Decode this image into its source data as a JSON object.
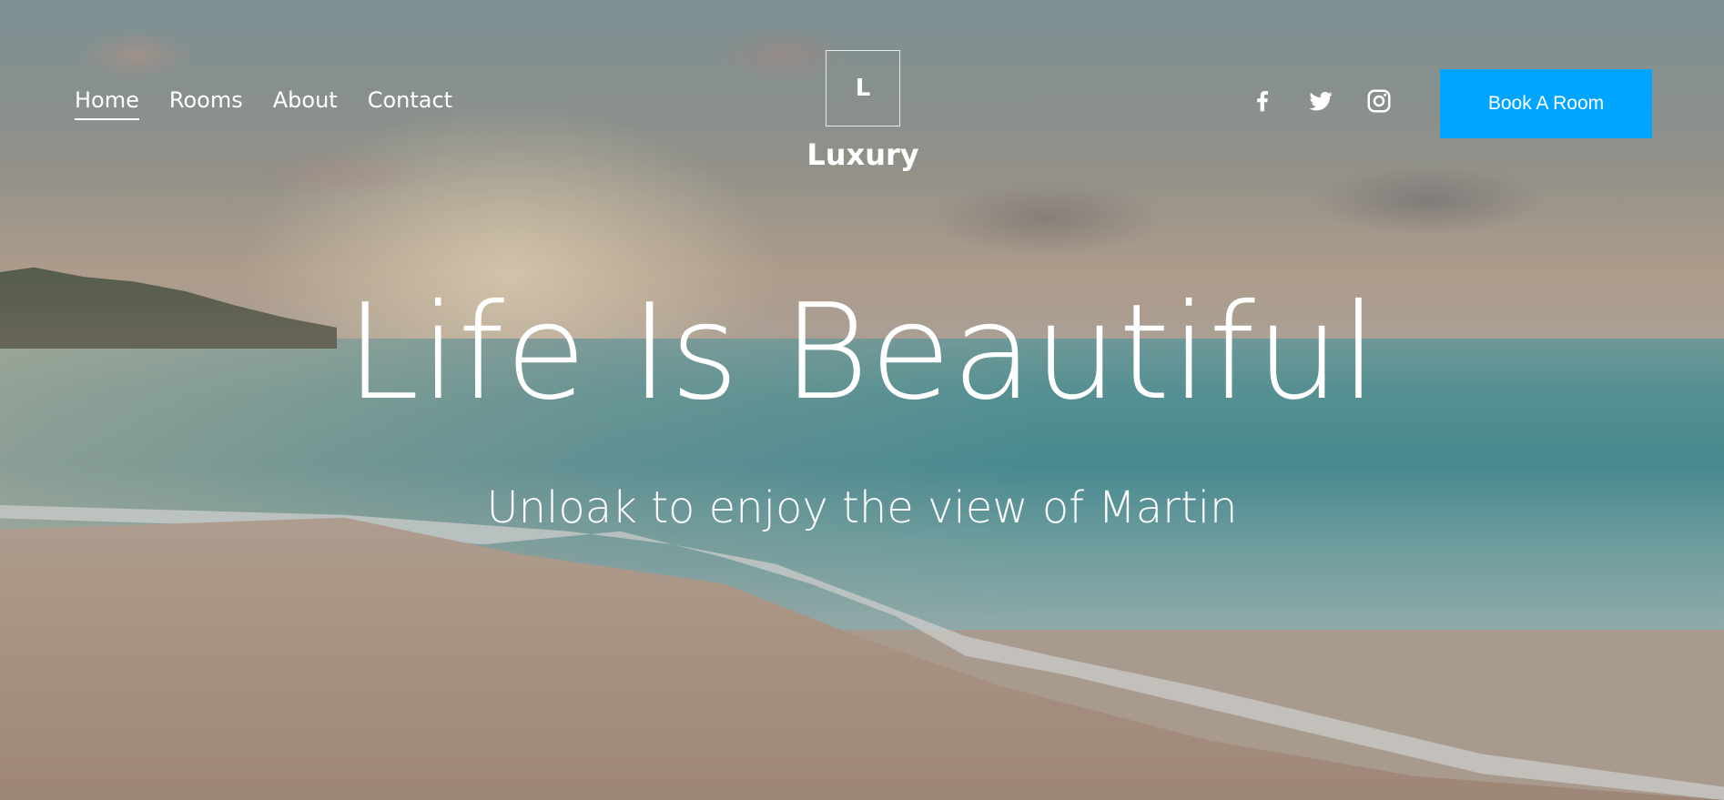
{
  "header": {
    "nav": [
      {
        "label": "Home",
        "active": true
      },
      {
        "label": "Rooms",
        "active": false
      },
      {
        "label": "About",
        "active": false
      },
      {
        "label": "Contact",
        "active": false
      }
    ],
    "logo_letter": "L",
    "brand_name": "Luxury",
    "social_icons": [
      "facebook-icon",
      "twitter-icon",
      "instagram-icon"
    ],
    "cta_label": "Book A Room",
    "cta_color": "#00a5ff"
  },
  "hero": {
    "title": "Life Is Beautiful",
    "subtitle": "Unloak to enjoy the view of Martin"
  }
}
